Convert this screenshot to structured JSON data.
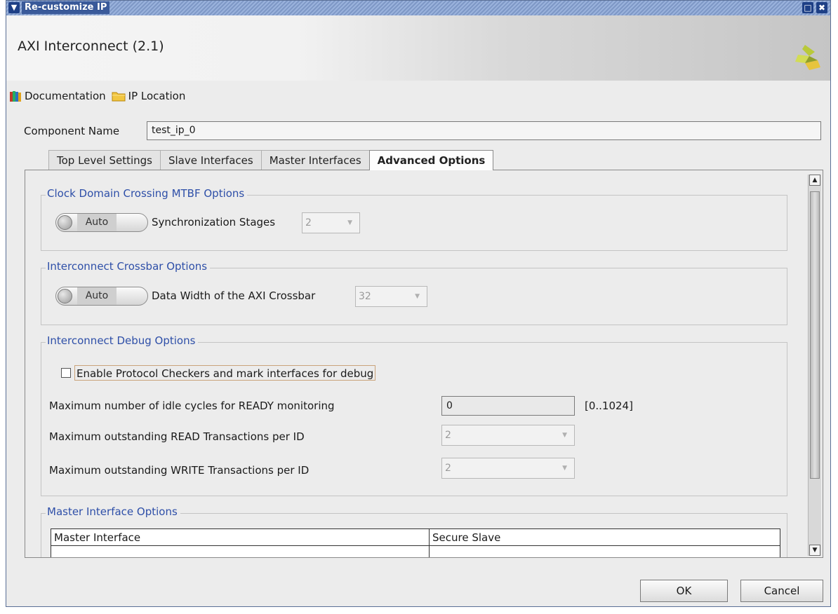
{
  "window": {
    "title": "Re-customize IP"
  },
  "header": {
    "title": "AXI Interconnect (2.1)"
  },
  "links": {
    "documentation": "Documentation",
    "ip_location": "IP Location"
  },
  "component": {
    "label": "Component Name",
    "value": "test_ip_0"
  },
  "tabs": [
    {
      "label": "Top Level Settings",
      "active": false
    },
    {
      "label": "Slave Interfaces",
      "active": false
    },
    {
      "label": "Master Interfaces",
      "active": false
    },
    {
      "label": "Advanced Options",
      "active": true
    }
  ],
  "clock_domain": {
    "title": "Clock Domain Crossing MTBF Options",
    "toggle": "Auto",
    "param_label": "Synchronization Stages",
    "param_value": "2"
  },
  "crossbar": {
    "title": "Interconnect Crossbar Options",
    "toggle": "Auto",
    "param_label": "Data Width of the AXI Crossbar",
    "param_value": "32"
  },
  "debug": {
    "title": "Interconnect Debug Options",
    "checkbox_label": "Enable Protocol Checkers and mark interfaces for debug",
    "checkbox_checked": false,
    "idle_label": "Maximum number of idle cycles for READY monitoring",
    "idle_value": "0",
    "idle_range": "[0..1024]",
    "read_label": "Maximum outstanding READ Transactions per ID",
    "read_value": "2",
    "write_label": "Maximum outstanding WRITE Transactions per ID",
    "write_value": "2"
  },
  "master_options": {
    "title": "Master Interface Options",
    "columns": [
      "Master Interface",
      "Secure Slave"
    ]
  },
  "buttons": {
    "ok": "OK",
    "cancel": "Cancel"
  },
  "colors": {
    "title_bar": "#8aa4d0",
    "group_title": "#2e4fa8"
  },
  "icons": {
    "window_menu": "chevron-down-icon",
    "maximize": "maximize-icon",
    "close": "close-icon",
    "documentation": "books-icon",
    "ip_location": "folder-icon",
    "brand": "xilinx-logo-icon"
  }
}
